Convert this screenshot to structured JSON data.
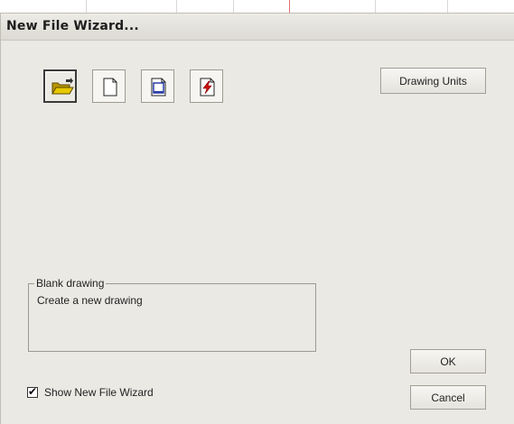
{
  "dialog": {
    "title": "New File Wizard..."
  },
  "toolbar": {
    "icons": [
      {
        "name": "open-folder-icon",
        "selected": true
      },
      {
        "name": "blank-page-icon",
        "selected": false
      },
      {
        "name": "template-page-icon",
        "selected": false
      },
      {
        "name": "pdf-page-icon",
        "selected": false
      }
    ]
  },
  "buttons": {
    "drawing_units": "Drawing Units",
    "ok": "OK",
    "cancel": "Cancel"
  },
  "description": {
    "legend": "Blank drawing",
    "text": "Create a new drawing"
  },
  "options": {
    "show_wizard_label": "Show New File Wizard",
    "show_wizard_checked": true,
    "check_glyph": "✔"
  },
  "colors": {
    "folder": "#d4b000",
    "template_accent": "#2b3fa8",
    "pdf_accent": "#d01010"
  }
}
